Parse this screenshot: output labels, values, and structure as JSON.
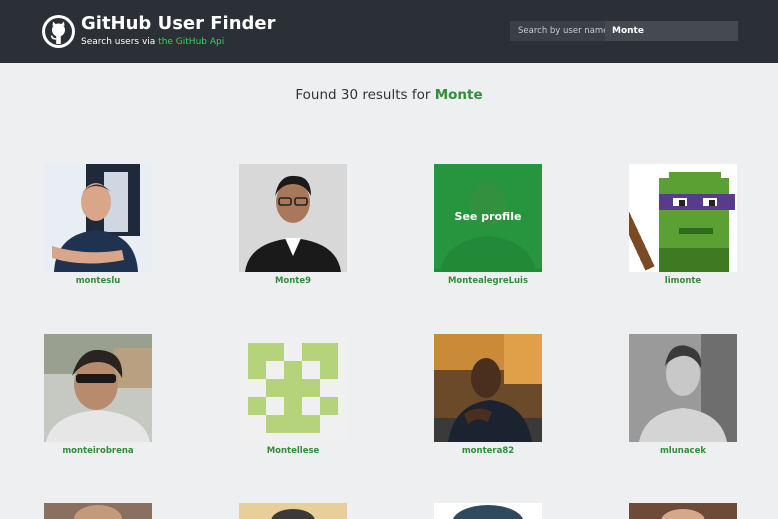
{
  "header": {
    "title": "GitHub User Finder",
    "subtitle_prefix": "Search users via ",
    "subtitle_link": "the GitHub Api"
  },
  "search": {
    "label": "Search by user name",
    "value": "Monte"
  },
  "results": {
    "prefix": "Found 30 results for ",
    "term": "Monte"
  },
  "hover_overlay": "See profile",
  "users": [
    {
      "login": "monteslu"
    },
    {
      "login": "Monte9"
    },
    {
      "login": "MontealegreLuis"
    },
    {
      "login": "limonte"
    },
    {
      "login": "monteirobrena"
    },
    {
      "login": "Montellese"
    },
    {
      "login": "montera82"
    },
    {
      "login": "mlunacek"
    }
  ],
  "colors": {
    "header_bg": "#2b2f36",
    "page_bg": "#eeeff1",
    "accent_green": "#2f8f3a",
    "link_green": "#3fce5a"
  }
}
